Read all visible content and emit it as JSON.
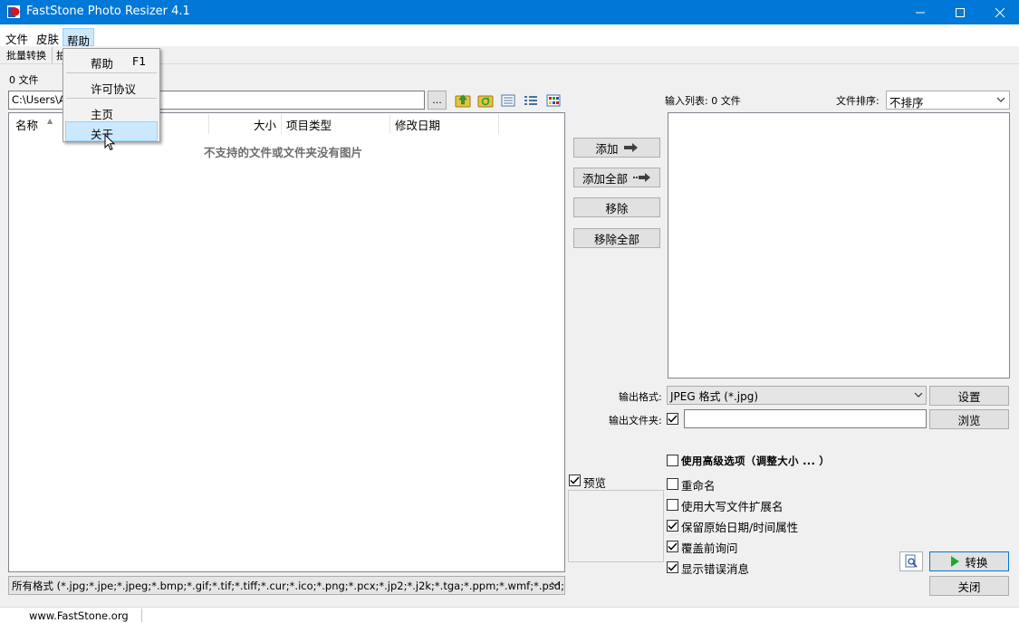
{
  "window": {
    "title": "FastStone Photo Resizer 4.1"
  },
  "menubar": {
    "file": "文件",
    "skin": "皮肤",
    "help": "帮助"
  },
  "tabs": {
    "batch_convert": "批量转换",
    "batch_rename_partial": "拍"
  },
  "help_menu": {
    "help": "帮助",
    "help_shortcut": "F1",
    "license": "许可协议",
    "home": "主页",
    "about": "关于"
  },
  "left": {
    "file_count": "0 文件",
    "path_value": "C:\\Users\\Ac",
    "browse_ellipsis": "...",
    "columns": {
      "name": "名称",
      "size": "大小",
      "type": "项目类型",
      "modified": "修改日期"
    },
    "empty_message": "不支持的文件或文件夹没有图片",
    "filter": "所有格式 (*.jpg;*.jpe;*.jpeg;*.bmp;*.gif;*.tif;*.tiff;*.cur;*.ico;*.png;*.pcx;*.jp2;*.j2k;*.tga;*.ppm;*.wmf;*.psd;*.eps"
  },
  "middle": {
    "add": "添加",
    "add_all": "添加全部",
    "remove": "移除",
    "remove_all": "移除全部",
    "preview_label": "预览",
    "preview_checked": true
  },
  "right": {
    "input_list_label": "输入列表: 0 文件",
    "sort_label": "文件排序:",
    "sort_value": "不排序",
    "output_format_label": "输出格式:",
    "output_format_value": "JPEG 格式 (*.jpg)",
    "settings_button": "设置",
    "output_folder_label": "输出文件夹:",
    "output_folder_checked": true,
    "output_folder_value": "",
    "browse_button": "浏览",
    "options": [
      {
        "label": "使用高级选项（调整大小 ... ）",
        "checked": false
      },
      {
        "label": "重命名",
        "checked": false
      },
      {
        "label": "使用大写文件扩展名",
        "checked": false
      },
      {
        "label": "保留原始日期/时间属性",
        "checked": true
      },
      {
        "label": "覆盖前询问",
        "checked": true
      },
      {
        "label": "显示错误消息",
        "checked": true
      }
    ],
    "convert_button": "转换",
    "close_button": "关闭"
  },
  "status": {
    "website": "www.FastStone.org"
  },
  "colors": {
    "titlebar": "#0078d7",
    "menu_highlight": "#cce8ff",
    "convert_arrow": "#1aab29"
  }
}
